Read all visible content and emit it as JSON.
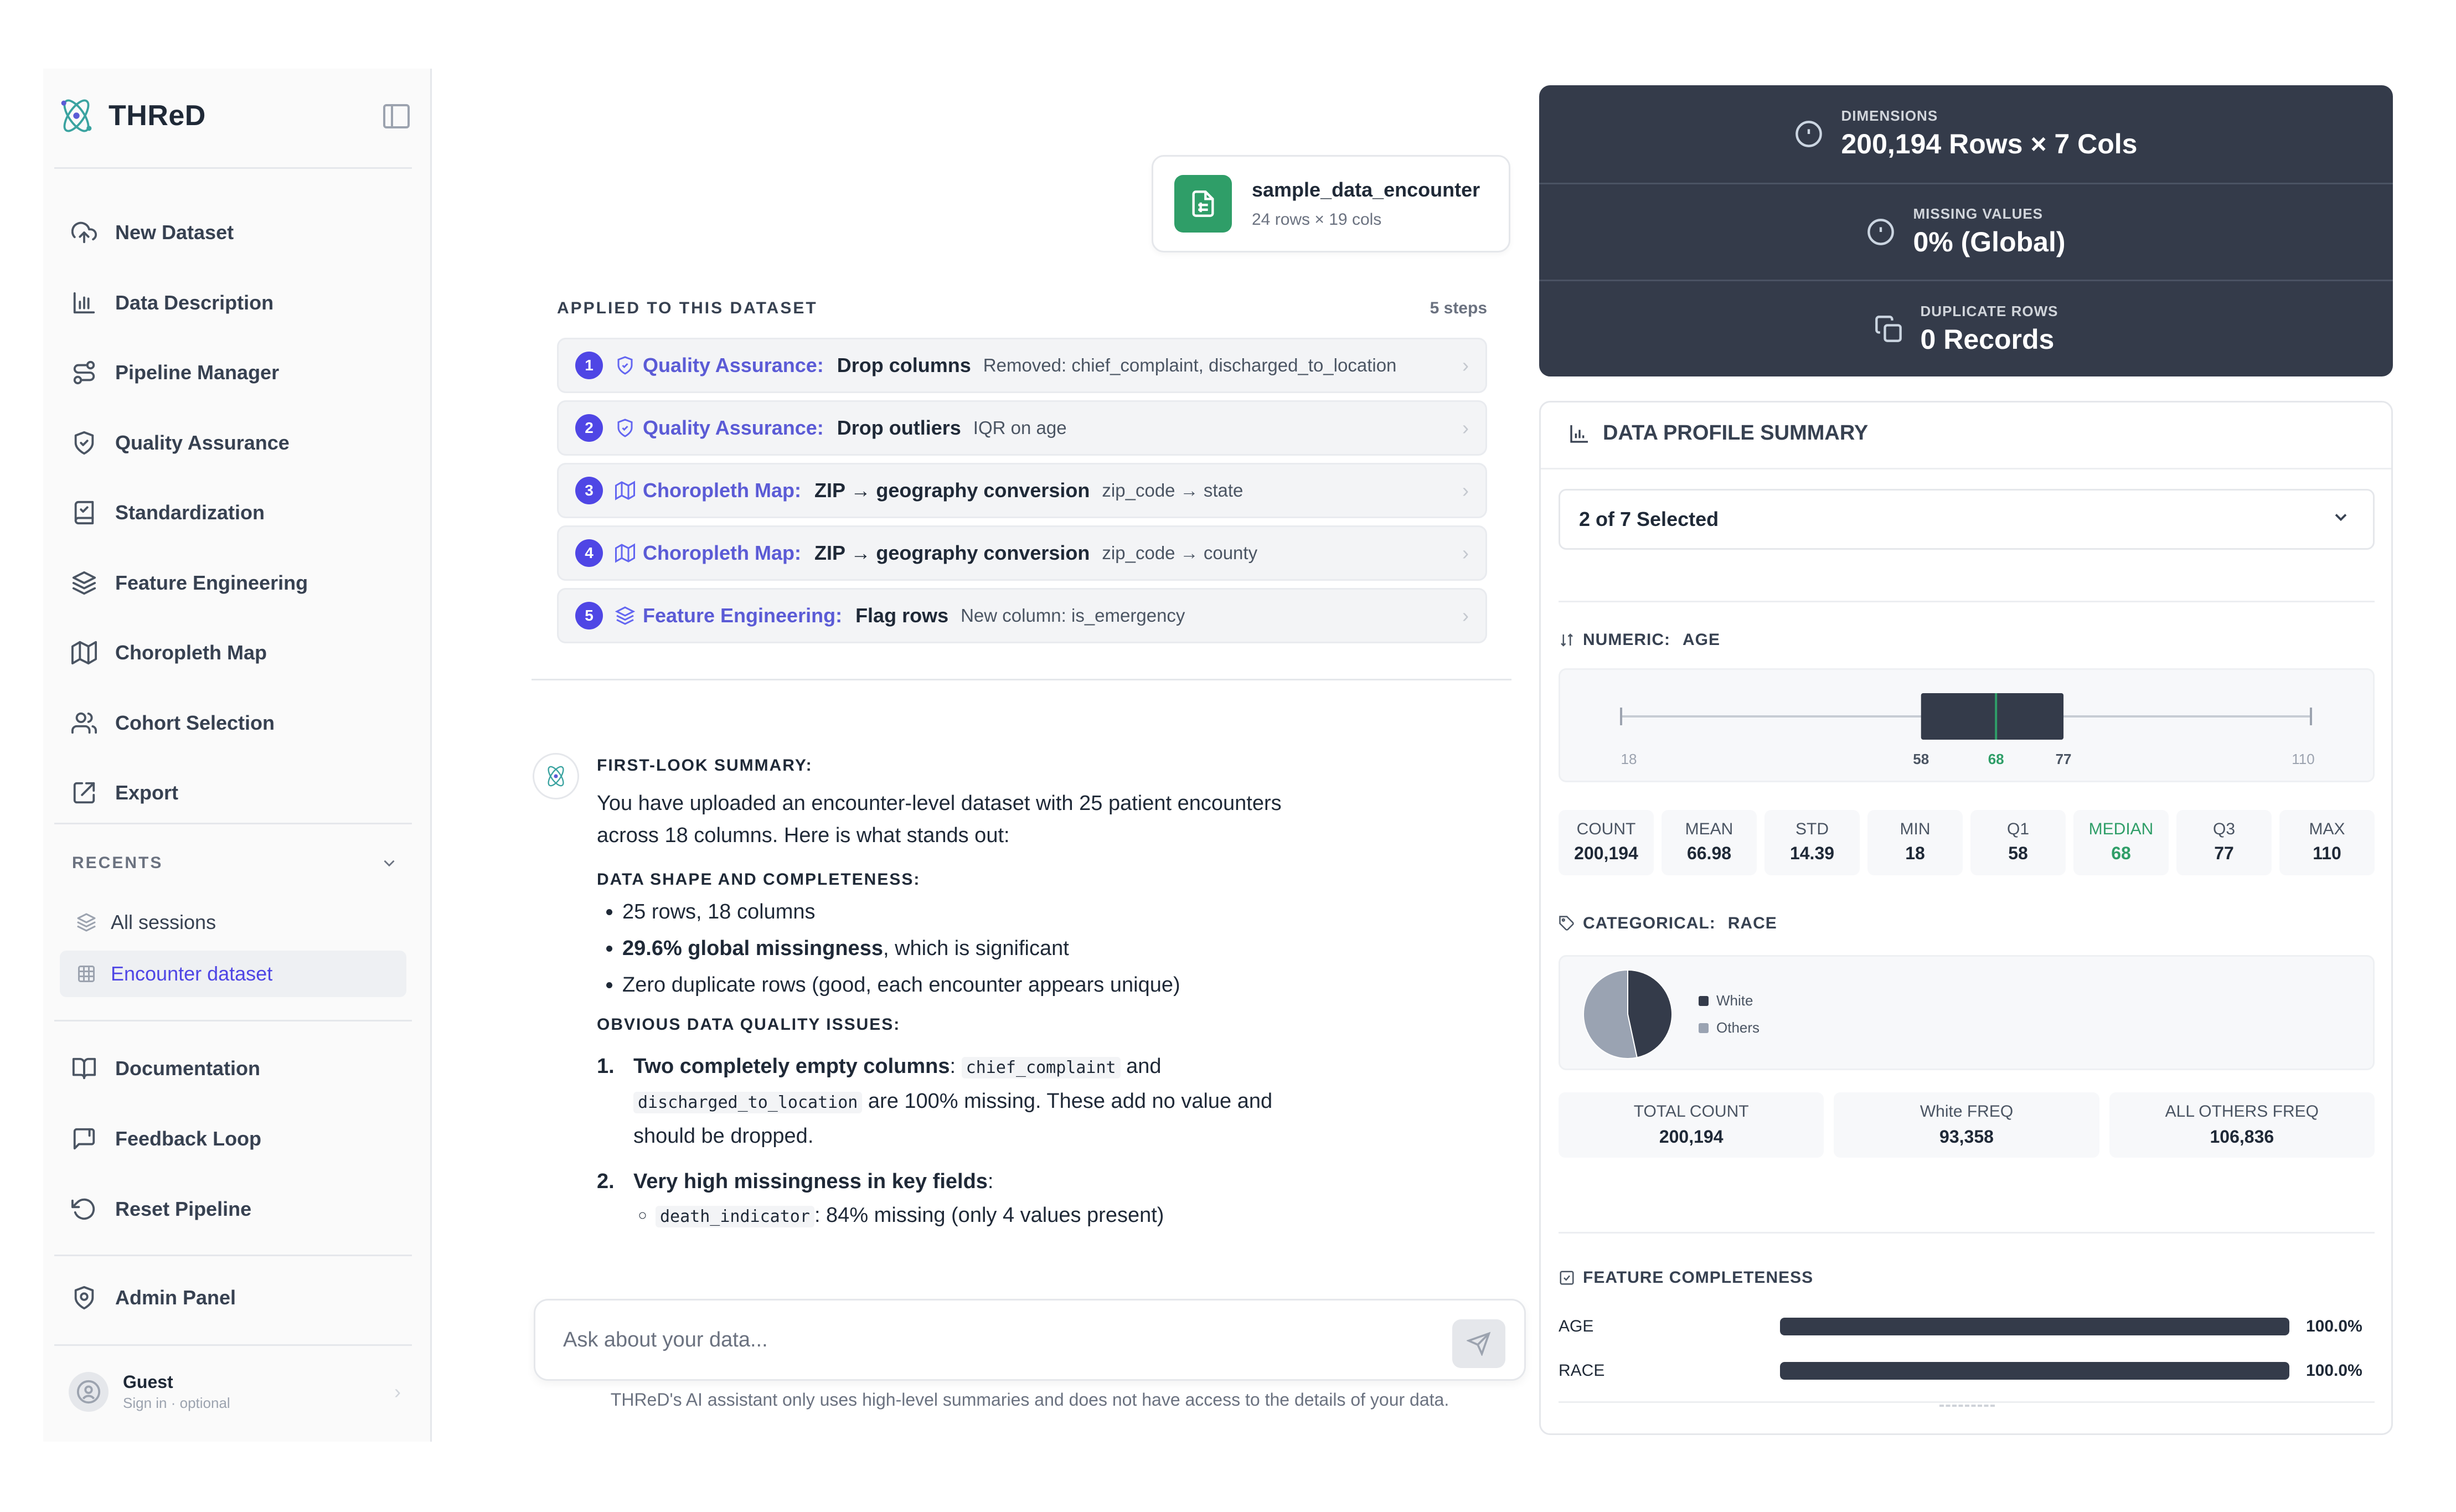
{
  "app": {
    "name": "THReD"
  },
  "sidebar": {
    "nav": [
      {
        "label": "New Dataset",
        "icon": "cloud-upload-icon"
      },
      {
        "label": "Data Description",
        "icon": "bar-chart-icon"
      },
      {
        "label": "Pipeline Manager",
        "icon": "route-icon"
      },
      {
        "label": "Quality Assurance",
        "icon": "shield-check-icon"
      },
      {
        "label": "Standardization",
        "icon": "book-check-icon"
      },
      {
        "label": "Feature Engineering",
        "icon": "layers-icon"
      },
      {
        "label": "Choropleth Map",
        "icon": "map-icon"
      },
      {
        "label": "Cohort Selection",
        "icon": "users-icon"
      },
      {
        "label": "Export",
        "icon": "export-icon"
      }
    ],
    "recents_label": "RECENTS",
    "recents": [
      {
        "label": "All sessions",
        "icon": "layers-icon",
        "active": false
      },
      {
        "label": "Encounter dataset",
        "icon": "table-icon",
        "active": true
      }
    ],
    "footer_nav": [
      {
        "label": "Documentation",
        "icon": "book-open-icon"
      },
      {
        "label": "Feedback Loop",
        "icon": "message-square-icon"
      },
      {
        "label": "Reset Pipeline",
        "icon": "rotate-ccw-icon"
      }
    ],
    "admin": {
      "label": "Admin Panel",
      "icon": "shield-gear-icon"
    },
    "user": {
      "name": "Guest",
      "sub": "Sign in · optional"
    }
  },
  "file": {
    "name": "sample_data_encounter",
    "meta": "24 rows × 19 cols"
  },
  "applied": {
    "title": "APPLIED TO THIS DATASET",
    "count": "5 steps",
    "steps": [
      {
        "num": "1",
        "category": "Quality Assurance:",
        "action": "Drop columns",
        "detail": "Removed: chief_complaint, discharged_to_location",
        "icon": "shield-icon"
      },
      {
        "num": "2",
        "category": "Quality Assurance:",
        "action": "Drop outliers",
        "detail": "IQR on age",
        "icon": "shield-icon"
      },
      {
        "num": "3",
        "category": "Choropleth Map:",
        "action": "ZIP → geography conversion",
        "detail": "zip_code → state",
        "icon": "map-icon"
      },
      {
        "num": "4",
        "category": "Choropleth Map:",
        "action": "ZIP → geography conversion",
        "detail": "zip_code → county",
        "icon": "map-icon"
      },
      {
        "num": "5",
        "category": "Feature Engineering:",
        "action": "Flag rows",
        "detail": "New column: is_emergency",
        "icon": "layers-icon"
      }
    ]
  },
  "message": {
    "heading1": "FIRST-LOOK SUMMARY:",
    "intro": "You have uploaded an encounter-level dataset with 25 patient encounters across 18 columns. Here is what stands out:",
    "heading2": "DATA SHAPE AND COMPLETENESS:",
    "bullet1": "25 rows, 18 columns",
    "bullet2_bold": "29.6% global missingness",
    "bullet2_rest": ", which is significant",
    "bullet3": "Zero duplicate rows (good, each encounter appears unique)",
    "heading3": "OBVIOUS DATA QUALITY ISSUES:",
    "item1_num": "1.",
    "item1_bold": "Two completely empty columns",
    "item1_colon": ":",
    "item1_code1": "chief_complaint",
    "item1_and": "and",
    "item1_code2": "discharged_to_location",
    "item1_rest": "are 100% missing. These add no value and should be dropped.",
    "item2_num": "2.",
    "item2_bold": "Very high missingness in key fields",
    "item2_colon": ":",
    "item2_sub_code": "death_indicator",
    "item2_sub_rest": ": 84% missing (only 4 values present)"
  },
  "chat_input": {
    "placeholder": "Ask about your data..."
  },
  "disclaimer": "THReD's AI assistant only uses high-level summaries and does not have access to the details of your data.",
  "stats": [
    {
      "label": "DIMENSIONS",
      "value": "200,194 Rows × 7 Cols",
      "icon": "alert-circle-icon"
    },
    {
      "label": "MISSING VALUES",
      "value": "0% (Global)",
      "icon": "alert-circle-icon"
    },
    {
      "label": "DUPLICATE ROWS",
      "value": "0 Records",
      "icon": "copy-icon"
    }
  ],
  "profile": {
    "title": "DATA PROFILE SUMMARY",
    "select_value": "2 of 7 Selected",
    "numeric": {
      "label": "NUMERIC:",
      "column": "AGE",
      "axis_min": "18",
      "axis_max": "110",
      "q1_label": "58",
      "median_label": "68",
      "q3_label": "77",
      "stats": [
        {
          "k": "COUNT",
          "v": "200,194"
        },
        {
          "k": "MEAN",
          "v": "66.98"
        },
        {
          "k": "STD",
          "v": "14.39"
        },
        {
          "k": "MIN",
          "v": "18"
        },
        {
          "k": "Q1",
          "v": "58"
        },
        {
          "k": "MEDIAN",
          "v": "68"
        },
        {
          "k": "Q3",
          "v": "77"
        },
        {
          "k": "MAX",
          "v": "110"
        }
      ]
    },
    "categorical": {
      "label": "CATEGORICAL:",
      "column": "RACE",
      "legend": [
        {
          "name": "White",
          "color": "#343b4a"
        },
        {
          "name": "Others",
          "color": "#9aa3b2"
        }
      ],
      "cells": [
        {
          "k": "TOTAL COUNT",
          "v": "200,194"
        },
        {
          "k": "White FREQ",
          "v": "93,358"
        },
        {
          "k": "ALL OTHERS FREQ",
          "v": "106,836"
        }
      ]
    },
    "completeness": {
      "title": "FEATURE COMPLETENESS",
      "rows": [
        {
          "label": "AGE",
          "value": "100.0%",
          "pct": 100
        },
        {
          "label": "RACE",
          "value": "100.0%",
          "pct": 100
        }
      ]
    }
  },
  "chart_data": [
    {
      "type": "box",
      "title": "AGE",
      "min": 18,
      "q1": 58,
      "median": 68,
      "q3": 77,
      "max": 110,
      "tick_labels": [
        "18",
        "58",
        "68",
        "77",
        "110"
      ]
    },
    {
      "type": "pie",
      "title": "RACE",
      "categories": [
        "White",
        "Others"
      ],
      "values": [
        93358,
        106836
      ]
    }
  ]
}
